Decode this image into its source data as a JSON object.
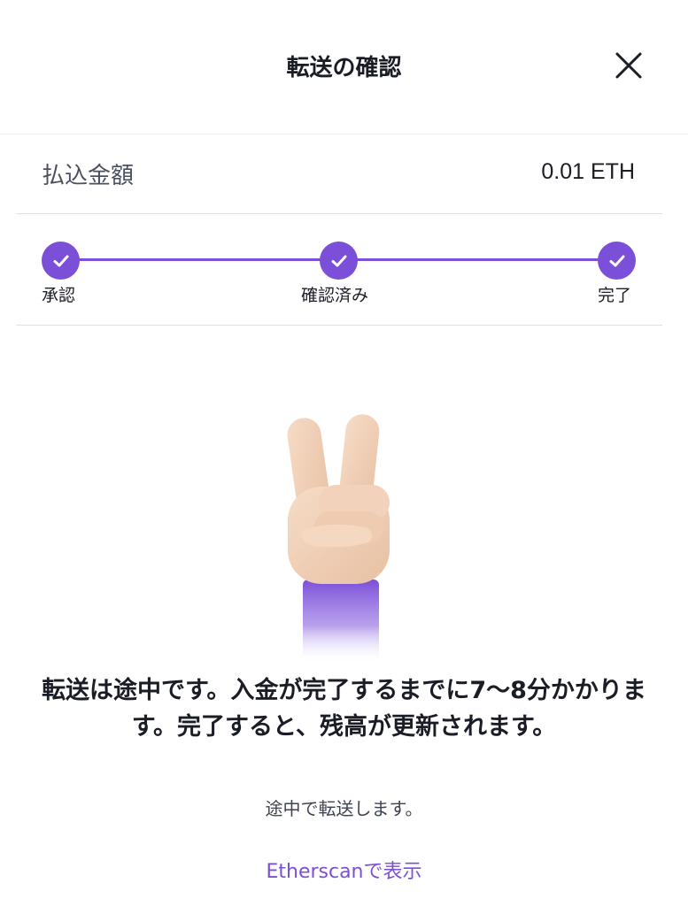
{
  "header": {
    "title": "転送の確認",
    "close_icon": "close-icon"
  },
  "amount": {
    "label": "払込金額",
    "value": "0.01 ETH"
  },
  "stepper": {
    "accent_color": "#7b4fd8",
    "steps": [
      {
        "label": "承認",
        "status": "completed",
        "icon": "check-icon"
      },
      {
        "label": "確認済み",
        "status": "completed",
        "icon": "check-icon"
      },
      {
        "label": "完了",
        "status": "completed",
        "icon": "check-icon"
      }
    ]
  },
  "illustration": {
    "icon": "victory-hand-icon"
  },
  "message": {
    "main": "転送は途中です。入金が完了するまでに7〜8分かかります。完了すると、残高が更新されます。",
    "sub": "途中で転送します。"
  },
  "link": {
    "label": "Etherscanで表示",
    "color": "#7b4fd8"
  }
}
